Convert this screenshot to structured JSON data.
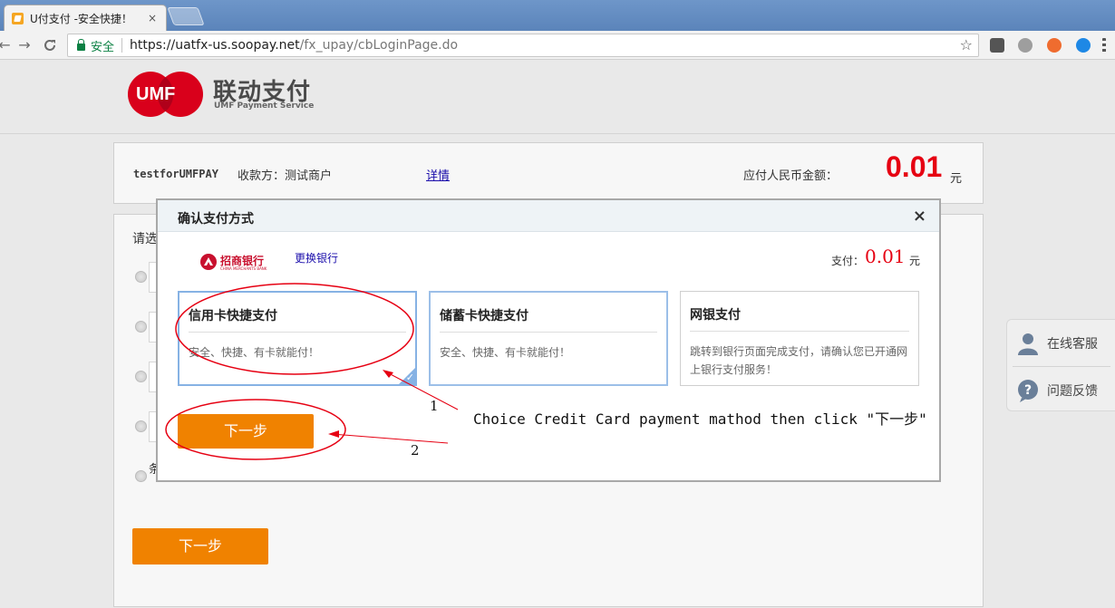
{
  "browser": {
    "tab_title": "U付支付 -安全快捷！",
    "tab_close": "×",
    "back": "←",
    "forward": "→",
    "reload": "C",
    "secure_label": "安全",
    "url_host": "https://uatfx-us.soopay.net",
    "url_path": "/fx_upay/cbLoginPage.do",
    "star": "☆"
  },
  "header": {
    "logo_text": "UMF",
    "brand_cn": "联动支付",
    "brand_en": "UMF Payment Service",
    "colors": {
      "brand_red": "#d9001b"
    }
  },
  "order": {
    "merchant_code": "testforUMFPAY",
    "payee": "收款方：测试商户",
    "detail_link": "详情",
    "rmb_label": "应付人民币金额：",
    "amount": "0.01",
    "unit": "元"
  },
  "method_panel": {
    "hint": "请选",
    "partial_letter": "条",
    "next_button": "下一步"
  },
  "side_widget": {
    "online_service": "在线客服",
    "feedback": "问题反馈"
  },
  "modal": {
    "title": "确认支付方式",
    "close": "×",
    "bank_name": "招商银行",
    "bank_name_en": "CHINA MERCHANTS BANK",
    "change_bank": "更换银行",
    "pay_label": "支付：",
    "pay_amount": "0.01",
    "pay_unit": "元",
    "options": [
      {
        "title": "信用卡快捷支付",
        "desc": "安全、快捷、有卡就能付！",
        "selected": true
      },
      {
        "title": "储蓄卡快捷支付",
        "desc": "安全、快捷、有卡就能付！",
        "selected": false
      },
      {
        "title": "网银支付",
        "desc": "跳转到银行页面完成支付，请确认您已开通网上银行支付服务！",
        "selected": false
      }
    ],
    "check": "✓",
    "next_button": "下一步",
    "colors": {
      "accent": "#f08200",
      "amount": "#e60012",
      "selected_border": "#86b2e4"
    }
  },
  "annotation": {
    "instruction": "Choice Credit Card payment mathod then click \"下一步\"",
    "step1": "1",
    "step2": "2",
    "color": "#e60012"
  }
}
